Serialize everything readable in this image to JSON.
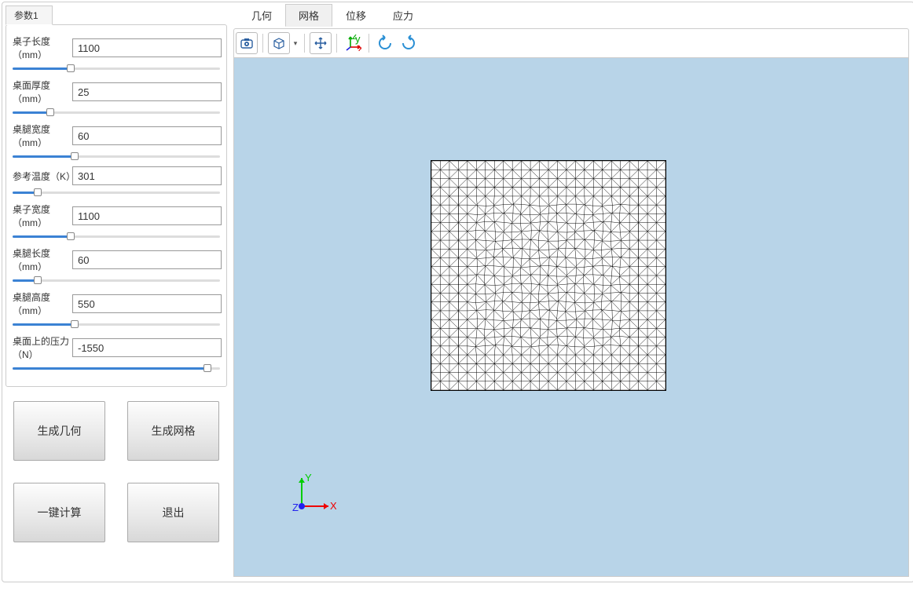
{
  "sidebar": {
    "tab_label": "参数1",
    "params": [
      {
        "label": "桌子长度（mm）",
        "value": "1100",
        "fill": 28
      },
      {
        "label": "桌面厚度（mm）",
        "value": "25",
        "fill": 18
      },
      {
        "label": "桌腿宽度（mm）",
        "value": "60",
        "fill": 30
      },
      {
        "label": "参考温度（K）",
        "value": "301",
        "fill": 12
      },
      {
        "label": "桌子宽度（mm）",
        "value": "1100",
        "fill": 28
      },
      {
        "label": "桌腿长度（mm）",
        "value": "60",
        "fill": 12
      },
      {
        "label": "桌腿高度（mm）",
        "value": "550",
        "fill": 30
      },
      {
        "label": "桌面上的压力（N）",
        "value": "-1550",
        "fill": 94
      }
    ]
  },
  "buttons": {
    "gen_geom": "生成几何",
    "gen_mesh": "生成网格",
    "compute": "一键计算",
    "exit": "退出"
  },
  "view_tabs": [
    "几何",
    "网格",
    "位移",
    "应力"
  ],
  "active_view_tab": 1,
  "toolbar_icons": [
    "camera-icon",
    "cube-icon",
    "move-icon",
    "axes-icon",
    "rotate-ccw-icon",
    "rotate-cw-icon"
  ],
  "triad": {
    "x": "X",
    "y": "Y",
    "z": "Z"
  }
}
